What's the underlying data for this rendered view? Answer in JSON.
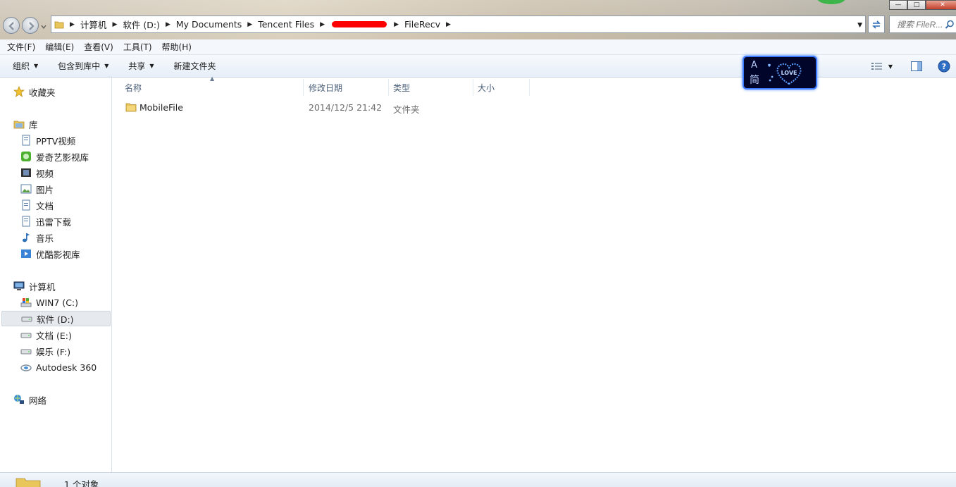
{
  "address": {
    "crumbs": [
      "计算机",
      "软件 (D:)",
      "My Documents",
      "Tencent Files",
      "FileRecv"
    ],
    "search_placeholder": "搜索 FileR..."
  },
  "window_controls": {
    "minimize": "—",
    "maximize": "□",
    "close": "✕"
  },
  "menubar": [
    "文件(F)",
    "编辑(E)",
    "查看(V)",
    "工具(T)",
    "帮助(H)"
  ],
  "toolbar": {
    "organize": "组织",
    "include_in_library": "包含到库中",
    "share": "共享",
    "new_folder": "新建文件夹"
  },
  "ime": {
    "letter": "A",
    "mode": "简",
    "badge": "LOVE"
  },
  "nav": {
    "favorites": "收藏夹",
    "libraries": "库",
    "library_items": [
      "PPTV视频",
      "爱奇艺影视库",
      "视频",
      "图片",
      "文档",
      "迅雷下载",
      "音乐",
      "优酷影视库"
    ],
    "computer": "计算机",
    "drives": [
      "WIN7 (C:)",
      "软件 (D:)",
      "文档 (E:)",
      "娱乐 (F:)",
      "Autodesk 360"
    ],
    "network": "网络"
  },
  "columns": [
    "名称",
    "修改日期",
    "类型",
    "大小"
  ],
  "files": [
    {
      "name": "MobileFile",
      "modified": "2014/12/5 21:42",
      "type": "文件夹",
      "size": ""
    }
  ],
  "status": {
    "count_text": "1 个对象"
  },
  "colors": {
    "redaction": "#ff0000",
    "selection": "#e6eaef",
    "header_text": "#4c607a"
  }
}
